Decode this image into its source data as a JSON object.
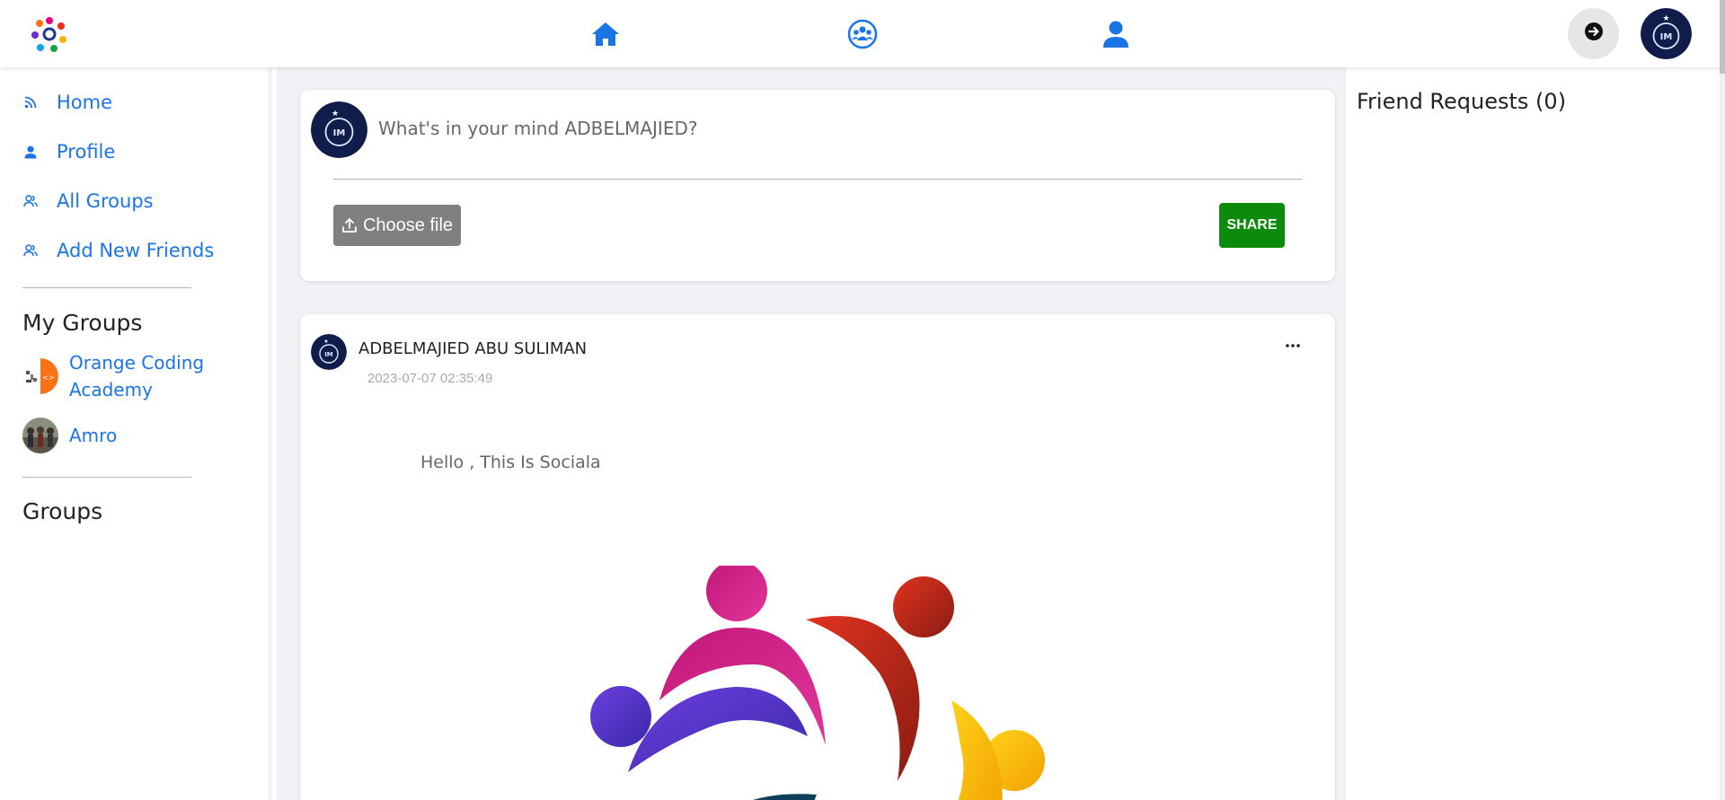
{
  "topbar": {
    "nav": [
      {
        "name": "home",
        "icon": "home-icon"
      },
      {
        "name": "groups",
        "icon": "groups-icon"
      },
      {
        "name": "profile",
        "icon": "user-icon"
      }
    ],
    "logout_icon": "logout-icon"
  },
  "sidebar": {
    "links": [
      {
        "label": "Home",
        "icon": "rss-icon"
      },
      {
        "label": "Profile",
        "icon": "user-icon"
      },
      {
        "label": "All Groups",
        "icon": "users-icon"
      },
      {
        "label": "Add New Friends",
        "icon": "users-icon"
      }
    ],
    "my_groups_heading": "My Groups",
    "my_groups": [
      {
        "name": "Orange Coding Academy"
      },
      {
        "name": "Amro"
      }
    ],
    "groups_heading": "Groups"
  },
  "composer": {
    "placeholder": "What's in your mind ADBELMAJIED?",
    "choose_file_label": "Choose file",
    "share_label": "SHARE"
  },
  "post": {
    "author": "ADBELMAJIED ABU SULIMAN",
    "timestamp": "2023-07-07 02:35:49",
    "text": "Hello , This Is Sociala"
  },
  "right": {
    "friend_requests_title": "Friend Requests (0)"
  },
  "colors": {
    "link_blue": "#1b74e4",
    "share_green": "#0b8a0b",
    "choose_gray": "#808080",
    "page_bg": "#f0f2f5"
  }
}
